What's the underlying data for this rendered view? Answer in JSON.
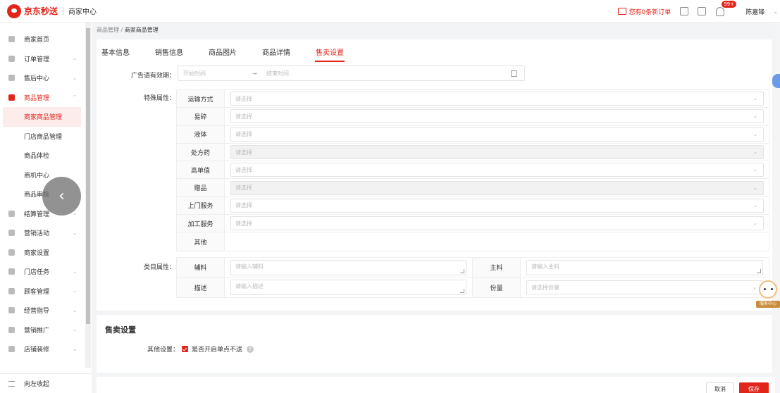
{
  "header": {
    "logo_text": "京东秒送",
    "logo_sub": "商家中心",
    "notice": "您有0条新订单",
    "badge": "99+",
    "user": "陈嘉锋"
  },
  "sidebar": {
    "items": [
      {
        "label": "商家首页",
        "icon": "home-icon"
      },
      {
        "label": "订单管理",
        "icon": "order-icon",
        "chevron": "⌄"
      },
      {
        "label": "售后中心",
        "icon": "aftersale-icon",
        "chevron": "⌄"
      },
      {
        "label": "商品管理",
        "icon": "goods-icon",
        "chevron": "⌃"
      },
      {
        "label": "商家商品管理"
      },
      {
        "label": "门店商品管理"
      },
      {
        "label": "商品体检"
      },
      {
        "label": "商机中心"
      },
      {
        "label": "商品审核"
      },
      {
        "label": "结算管理",
        "icon": "settle-icon",
        "chevron": "⌄"
      },
      {
        "label": "营销活动",
        "icon": "marketing-icon",
        "chevron": "⌄"
      },
      {
        "label": "商家设置",
        "icon": "setting-icon"
      },
      {
        "label": "门店任务",
        "icon": "task-icon",
        "chevron": "⌄"
      },
      {
        "label": "顾客管理",
        "icon": "customer-icon",
        "chevron": "⌄"
      },
      {
        "label": "经营指导",
        "icon": "guide-icon",
        "chevron": "⌄"
      },
      {
        "label": "营销推广",
        "icon": "promote-icon",
        "chevron": "⌄"
      },
      {
        "label": "店铺装修",
        "icon": "decor-icon",
        "chevron": "⌄"
      }
    ],
    "collapse_label": "向左收起",
    "fab_glyph": "‹"
  },
  "breadcrumb": {
    "parent": "商品管理",
    "sep": "/",
    "current": "商家商品管理"
  },
  "tabs": [
    "基本信息",
    "销售信息",
    "商品图片",
    "商品详情",
    "售卖设置"
  ],
  "form": {
    "ad_label": "广告语有效期：",
    "start_placeholder": "开始时间",
    "arrow": "→",
    "end_placeholder": "结束时间",
    "special_label": "特殊属性：",
    "special_attrs": [
      {
        "key": "运输方式",
        "placeholder": "请选择",
        "disabled": false
      },
      {
        "key": "易碎",
        "placeholder": "请选择",
        "disabled": false
      },
      {
        "key": "液体",
        "placeholder": "请选择",
        "disabled": false
      },
      {
        "key": "处方药",
        "placeholder": "请选择",
        "disabled": true
      },
      {
        "key": "高单值",
        "placeholder": "请选择",
        "disabled": false
      },
      {
        "key": "赠品",
        "placeholder": "请选择",
        "disabled": true
      },
      {
        "key": "上门服务",
        "placeholder": "请选择",
        "disabled": false
      },
      {
        "key": "加工服务",
        "placeholder": "请选择",
        "disabled": false
      }
    ],
    "other_key": "其他",
    "category_label": "类目属性：",
    "category": [
      {
        "key": "辅料",
        "placeholder": "请输入辅料",
        "key2": "主料",
        "placeholder2": "请输入主料"
      },
      {
        "key": "描述",
        "placeholder": "请输入描述",
        "key2": "份量",
        "placeholder2": "请选择份量"
      }
    ]
  },
  "sale": {
    "title": "售卖设置",
    "other_label": "其他设置：",
    "checkbox_label": "是否开启单点不送",
    "help_glyph": "?"
  },
  "footer": {
    "cancel": "取消",
    "save": "保存"
  },
  "service_label": "服务中心",
  "colors": {
    "accent": "#e1251b"
  }
}
